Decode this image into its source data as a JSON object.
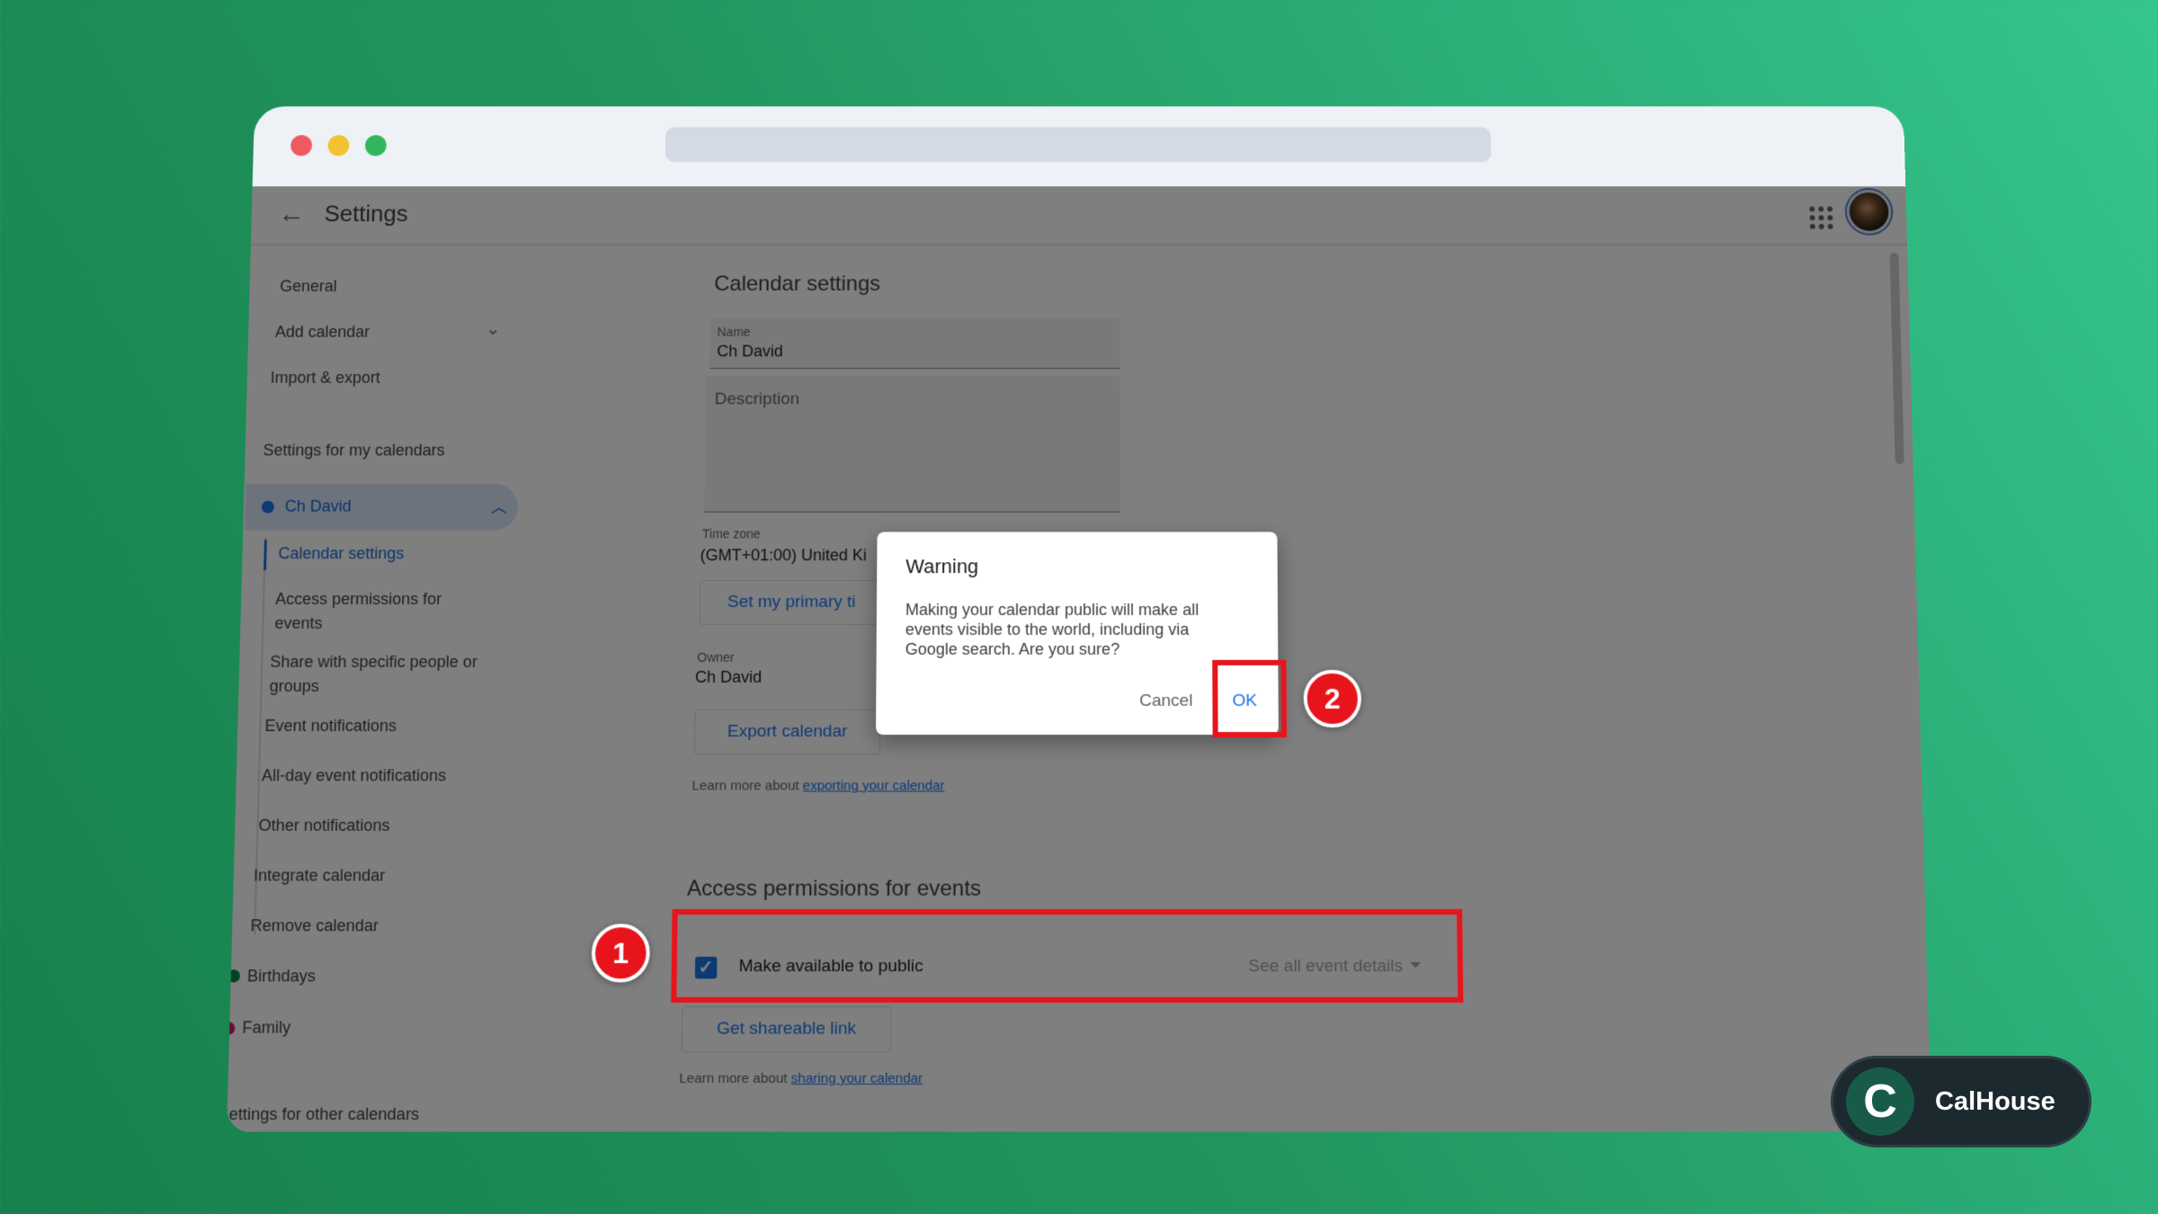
{
  "app": {
    "title": "Settings"
  },
  "sidebar": {
    "nav": [
      "General",
      "Add calendar",
      "Import & export"
    ],
    "my_calendars_title": "Settings for my calendars",
    "active_calendar": "Ch David",
    "sub_items": [
      "Calendar settings",
      "Access permissions for events",
      "Share with specific people or groups",
      "Event notifications",
      "All-day event notifications",
      "Other notifications",
      "Integrate calendar",
      "Remove calendar"
    ],
    "other_cals": [
      {
        "name": "Birthdays",
        "color": "#0b8043"
      },
      {
        "name": "Family",
        "color": "#d81b60"
      }
    ],
    "other_calendars_title": "Settings for other calendars"
  },
  "main": {
    "calendar_settings_title": "Calendar settings",
    "name_label": "Name",
    "name_value": "Ch David",
    "description_placeholder": "Description",
    "timezone_label": "Time zone",
    "timezone_value": "(GMT+01:00) United Ki",
    "set_primary_tz": "Set my primary ti",
    "owner_label": "Owner",
    "owner_value": "Ch David",
    "export_button": "Export calendar",
    "learn_export_prefix": "Learn more about",
    "learn_export_link": "exporting your calendar",
    "access_title": "Access permissions for events",
    "make_public_label": "Make available to public",
    "make_public_checked": true,
    "visibility_select": "See all event details",
    "shareable_button": "Get shareable link",
    "learn_share_prefix": "Learn more about",
    "learn_share_link": "sharing your calendar"
  },
  "dialog": {
    "title": "Warning",
    "body": "Making your calendar public will make all events visible to the world, including via Google search. Are you sure?",
    "cancel": "Cancel",
    "ok": "OK"
  },
  "annotations": {
    "step1": "1",
    "step2": "2",
    "color": "#e8141c"
  },
  "brand": {
    "logo_letter": "C",
    "name": "CalHouse"
  }
}
